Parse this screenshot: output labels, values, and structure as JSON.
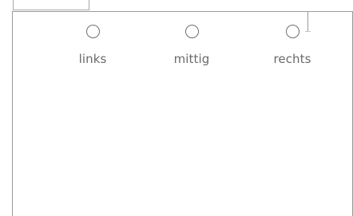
{
  "alignment_options": [
    {
      "id": "left",
      "label": "links",
      "selected": false
    },
    {
      "id": "center",
      "label": "mittig",
      "selected": false
    },
    {
      "id": "right",
      "label": "rechts",
      "selected": false
    }
  ],
  "colors": {
    "border": "#9a9a9a",
    "radio_border": "#6f6f6f",
    "label_text": "#6a6a6a",
    "background": "#ffffff"
  }
}
